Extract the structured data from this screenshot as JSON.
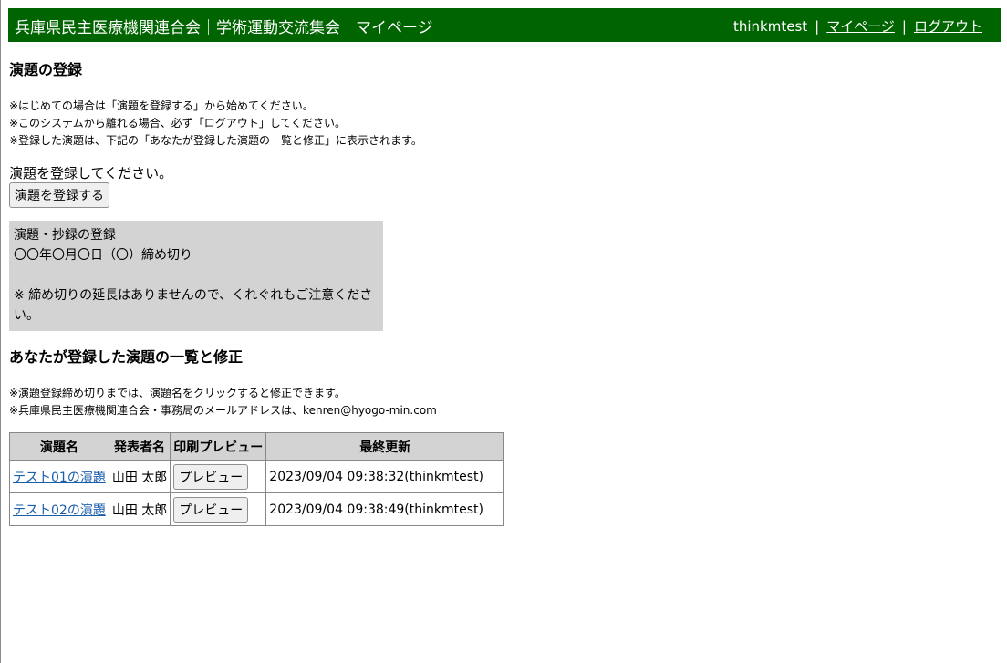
{
  "header": {
    "title": "兵庫県民主医療機関連合会｜学術運動交流集会｜マイページ",
    "user": "thinkmtest",
    "sep": "|",
    "mypage_link": "マイページ",
    "logout_link": "ログアウト"
  },
  "register": {
    "heading": "演題の登録",
    "notes": [
      "※はじめての場合は「演題を登録する」から始めてください。",
      "※このシステムから離れる場合、必ず「ログアウト」してください。",
      "※登録した演題は、下記の「あなたが登録した演題の一覧と修正」に表示されます。"
    ],
    "prompt": "演題を登録してください。",
    "button_label": "演題を登録する"
  },
  "deadline": {
    "title": "演題・抄録の登録",
    "date": "〇〇年〇月〇日（〇）締め切り",
    "warning": "※ 締め切りの延長はありませんので、くれぐれもご注意ください。"
  },
  "list": {
    "heading": "あなたが登録した演題の一覧と修正",
    "notes": [
      "※演題登録締め切りまでは、演題名をクリックすると修正できます。",
      "※兵庫県民主医療機関連合会・事務局のメールアドレスは、kenren@hyogo-min.com"
    ],
    "columns": [
      "演題名",
      "発表者名",
      "印刷プレビュー",
      "最終更新"
    ],
    "rows": [
      {
        "title": "テスト01の演題",
        "presenter": "山田 太郎",
        "preview_label": "プレビュー",
        "updated": "2023/09/04 09:38:32(thinkmtest)"
      },
      {
        "title": "テスト02の演題",
        "presenter": "山田 太郎",
        "preview_label": "プレビュー",
        "updated": "2023/09/04 09:38:49(thinkmtest)"
      }
    ]
  },
  "colors": {
    "header_bg": "#006400",
    "box_bg": "#d3d3d3",
    "link": "#1a5dab"
  }
}
